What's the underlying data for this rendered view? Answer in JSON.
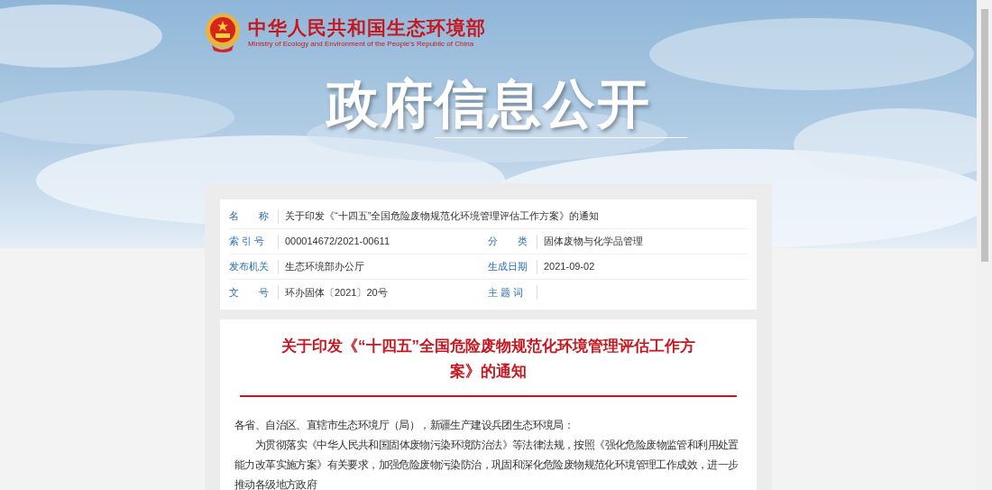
{
  "header": {
    "site_name": "中华人民共和国生态环境部",
    "site_name_en": "Ministry of Ecology and Environment of the People's Republic of China",
    "banner_title": "政府信息公开"
  },
  "info_table": {
    "rows": [
      [
        {
          "label": "名　　称",
          "value": "关于印发《“十四五”全国危险废物规范化环境管理评估工作方案》的通知"
        }
      ],
      [
        {
          "label": "索 引 号",
          "value": "000014672/2021-00611"
        },
        {
          "label": "分　　类",
          "value": "固体废物与化学品管理"
        }
      ],
      [
        {
          "label": "发布机关",
          "value": "生态环境部办公厅"
        },
        {
          "label": "生成日期",
          "value": "2021-09-02"
        }
      ],
      [
        {
          "label": "文　　号",
          "value": "环办固体〔2021〕20号"
        },
        {
          "label": "主 题 词"
        }
      ]
    ]
  },
  "article": {
    "title": "关于印发《“十四五”全国危险废物规范化环境管理评估工作方案》的通知",
    "salutation": "各省、自治区、直辖市生态环境厅（局），新疆生产建设兵团生态环境局：",
    "paragraphs": [
      "为贯彻落实《中华人民共和国固体废物污染环境防治法》等法律法规，按照《强化危险废物监管和利用处置能力改革实施方案》有关要求，加强危险废物污染防治，巩固和深化危险废物规范化环境管理工作成效，进一步推动各级地方政府"
    ]
  }
}
